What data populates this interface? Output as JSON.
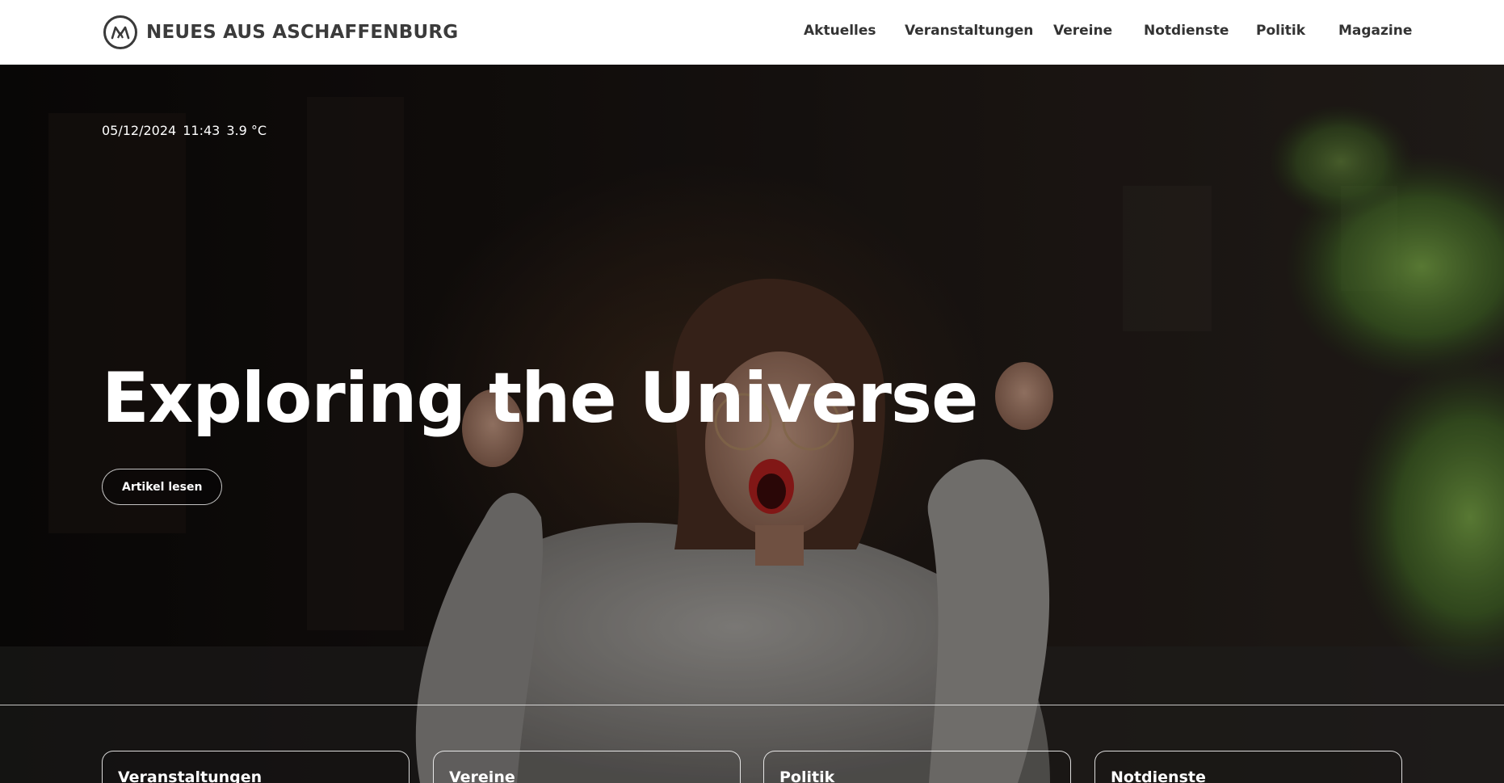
{
  "header": {
    "brand": "NEUES AUS ASCHAFFENBURG",
    "logo_icon": "ma-monogram-logo",
    "nav": [
      "Aktuelles",
      "Veranstaltungen",
      "Vereine",
      "Notdienste",
      "Politik",
      "Magazine"
    ]
  },
  "hero": {
    "date": "05/12/2024",
    "time": "11:43",
    "temperature": "3.9 °C",
    "title": "Exploring the Universe",
    "button_label": "Artikel lesen"
  },
  "cards": [
    "Veranstaltungen",
    "Vereine",
    "Politik",
    "Notdienste"
  ],
  "colors": {
    "header_bg": "#ffffff",
    "nav_text": "#333333",
    "hero_text": "#ffffff"
  }
}
